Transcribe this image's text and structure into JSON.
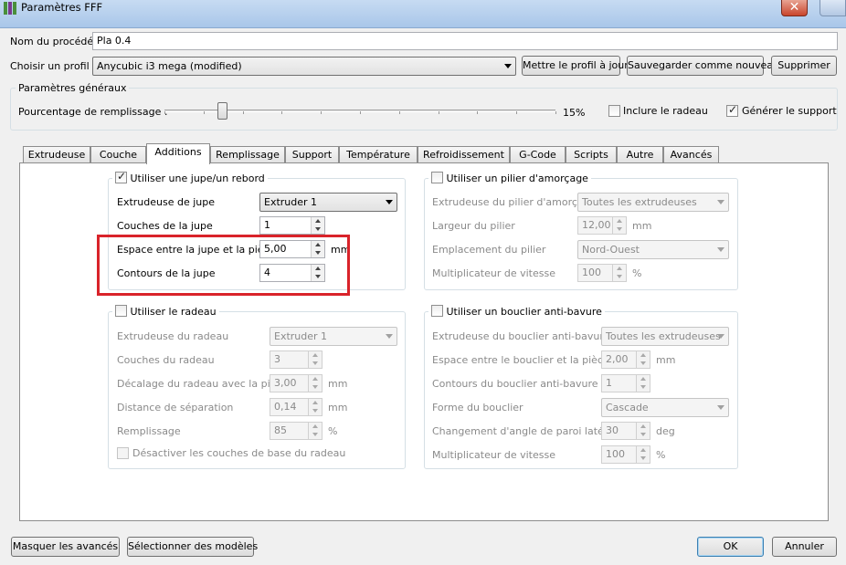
{
  "window": {
    "title": "Paramètres FFF"
  },
  "header": {
    "process_name_label": "Nom du procédé :",
    "process_name_value": "Pla 0.4",
    "profile_label": "Choisir un profil :",
    "profile_value": "Anycubic i3 mega (modified)",
    "update_profile_button": "Mettre le profil à jour",
    "save_as_new_button": "Sauvegarder comme nouveau",
    "delete_button": "Supprimer"
  },
  "general": {
    "title": "Paramètres généraux",
    "infill_label": "Pourcentage de remplissage :",
    "infill_value": "15%",
    "infill_fraction": 0.15,
    "include_raft_label": "Inclure le radeau",
    "include_raft_checked": false,
    "generate_support_label": "Générer le support",
    "generate_support_checked": true
  },
  "tabs": [
    "Extrudeuse",
    "Couche",
    "Additions",
    "Remplissage",
    "Support",
    "Température",
    "Refroidissement",
    "G-Code",
    "Scripts",
    "Autre",
    "Avancés"
  ],
  "active_tab": "Additions",
  "skirt": {
    "title": "Utiliser une jupe/un rebord",
    "checked": true,
    "extruder_label": "Extrudeuse de jupe",
    "extruder_value": "Extruder 1",
    "layers_label": "Couches de la jupe",
    "layers_value": "1",
    "distance_label": "Espace entre la jupe et la pièce",
    "distance_value": "5,00",
    "distance_unit": "mm",
    "outlines_label": "Contours de la jupe",
    "outlines_value": "4"
  },
  "prime_pillar": {
    "title": "Utiliser un pilier d'amorçage",
    "checked": false,
    "extruder_label": "Extrudeuse du pilier d'amorçage",
    "extruder_value": "Toutes les extrudeuses",
    "width_label": "Largeur du pilier",
    "width_value": "12,00",
    "width_unit": "mm",
    "location_label": "Emplacement du pilier",
    "location_value": "Nord-Ouest",
    "speed_label": "Multiplicateur de vitesse",
    "speed_value": "100",
    "speed_unit": "%"
  },
  "raft": {
    "title": "Utiliser le radeau",
    "checked": false,
    "extruder_label": "Extrudeuse du radeau",
    "extruder_value": "Extruder 1",
    "layers_label": "Couches du radeau",
    "layers_value": "3",
    "offset_label": "Décalage du radeau avec la pièce",
    "offset_value": "3,00",
    "offset_unit": "mm",
    "separation_label": "Distance de séparation",
    "separation_value": "0,14",
    "separation_unit": "mm",
    "infill_label": "Remplissage",
    "infill_value": "85",
    "infill_unit": "%",
    "disable_base_label": "Désactiver les couches de base du radeau"
  },
  "ooze_shield": {
    "title": "Utiliser un bouclier anti-bavure",
    "checked": false,
    "extruder_label": "Extrudeuse du bouclier anti-bavure",
    "extruder_value": "Toutes les extrudeuses",
    "distance_label": "Espace entre le bouclier et la pièce",
    "distance_value": "2,00",
    "distance_unit": "mm",
    "outlines_label": "Contours du bouclier anti-bavure",
    "outlines_value": "1",
    "shape_label": "Forme du bouclier",
    "shape_value": "Cascade",
    "angle_label": "Changement d'angle de paroi latérale",
    "angle_value": "30",
    "angle_unit": "deg",
    "speed_label": "Multiplicateur de vitesse",
    "speed_value": "100",
    "speed_unit": "%"
  },
  "footer": {
    "hide_advanced_button": "Masquer les avancés",
    "select_models_button": "Sélectionner des modèles",
    "ok_button": "OK",
    "cancel_button": "Annuler"
  },
  "colors": {
    "highlight": "#d9232a",
    "ok_border": "#3c7fb1"
  }
}
